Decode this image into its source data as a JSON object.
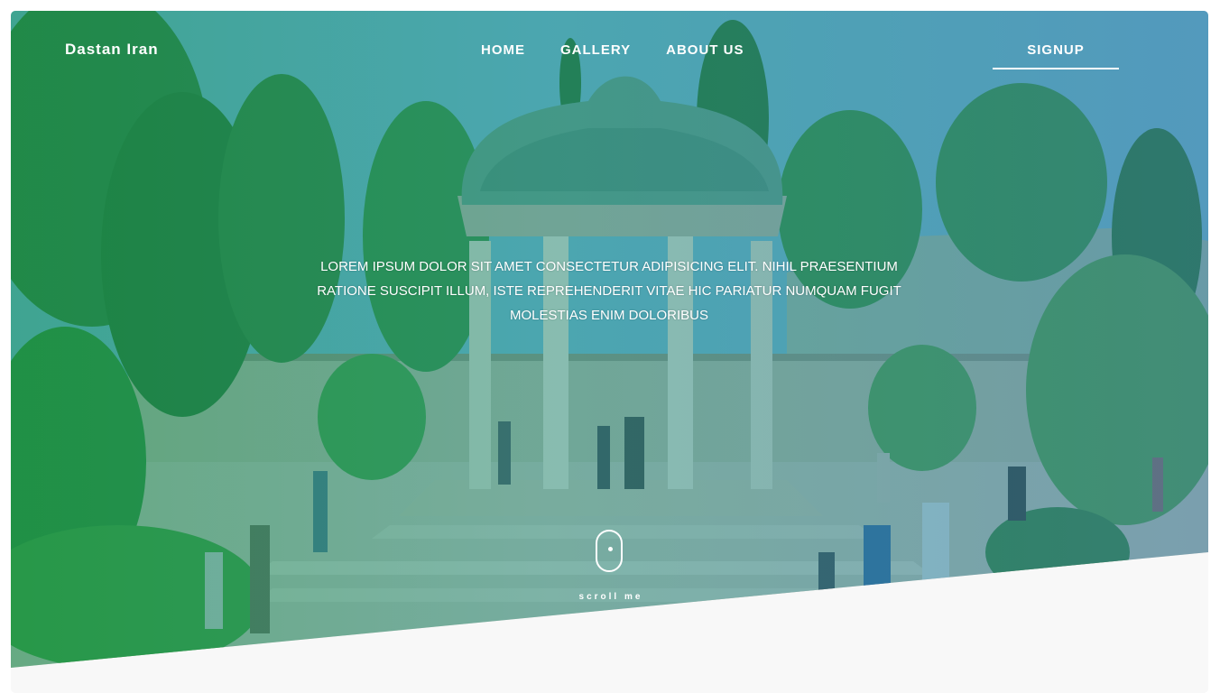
{
  "nav": {
    "brand": "Dastan Iran",
    "links": [
      "HOME",
      "GALLERY",
      "ABOUT US"
    ],
    "signup": "SIGNUP"
  },
  "hero": {
    "tagline": "Lorem ipsum dolor sit amet consectetur adipisicing elit. Nihil praesentium ratione suscipit illum, iste reprehenderit vitae hic pariatur numquam fugit molestias enim doloribus",
    "scroll_label": "scroll me"
  },
  "colors": {
    "overlay_left": "#18965a",
    "overlay_right": "#3c82aa",
    "text": "#ffffff",
    "below_section": "#f8f8f8"
  },
  "icons": [
    "scroll-mouse-icon"
  ]
}
